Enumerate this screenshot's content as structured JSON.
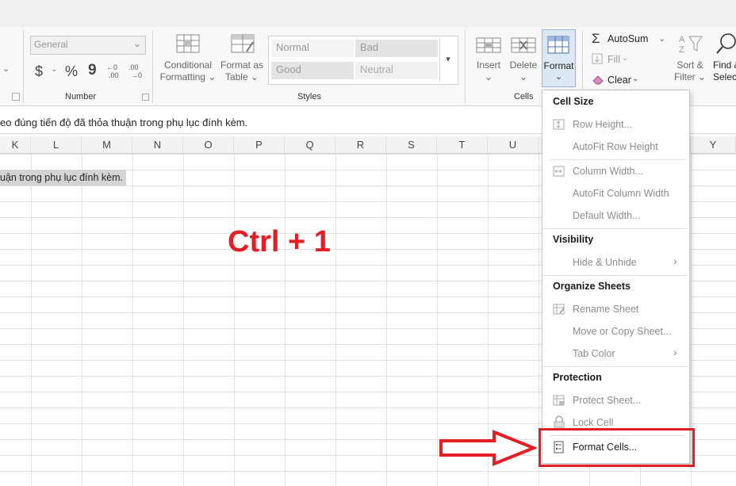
{
  "ribbon": {
    "number_format_value": "General",
    "number_symbols": {
      "currency": "$",
      "percent": "%",
      "comma": "9"
    },
    "number_group_label": "Number",
    "conditional_formatting": [
      "Conditional",
      "Formatting"
    ],
    "format_as_table": [
      "Format as",
      "Table"
    ],
    "styles": {
      "normal": "Normal",
      "bad": "Bad",
      "good": "Good",
      "neutral": "Neutral"
    },
    "styles_group_label": "Styles",
    "insert_label": "Insert",
    "delete_label": "Delete",
    "format_label": "Format",
    "cells_group_label": "Cells",
    "autosum_label": "AutoSum",
    "fill_label": "Fill",
    "clear_label": "Clear",
    "sort_filter": [
      "Sort &",
      "Filter"
    ],
    "find_select": [
      "Find &",
      "Select"
    ]
  },
  "formula_bar_text": "eo đúng tiến độ đã thỏa thuận trong phụ lục đính kèm.",
  "columns": [
    "K",
    "L",
    "M",
    "N",
    "O",
    "P",
    "Q",
    "R",
    "S",
    "T",
    "U",
    "Y"
  ],
  "cell_text": "uận trong phụ lục đính kèm.",
  "overlay_text": "Ctrl + 1",
  "colors": {
    "overlay_red": "#e31e24",
    "highlight_border": "#e31e24",
    "selected_format": "#dde8f5"
  },
  "format_menu": {
    "cell_size_header": "Cell Size",
    "row_height": "Row Height...",
    "autofit_row_height": "AutoFit Row Height",
    "column_width": "Column Width...",
    "autofit_column_width": "AutoFit Column Width",
    "default_width": "Default Width...",
    "visibility_header": "Visibility",
    "hide_unhide": "Hide & Unhide",
    "organize_header": "Organize Sheets",
    "rename_sheet": "Rename Sheet",
    "move_copy_sheet": "Move or Copy Sheet...",
    "tab_color": "Tab Color",
    "protection_header": "Protection",
    "protect_sheet": "Protect Sheet...",
    "lock_cell": "Lock Cell",
    "format_cells": "Format Cells..."
  }
}
